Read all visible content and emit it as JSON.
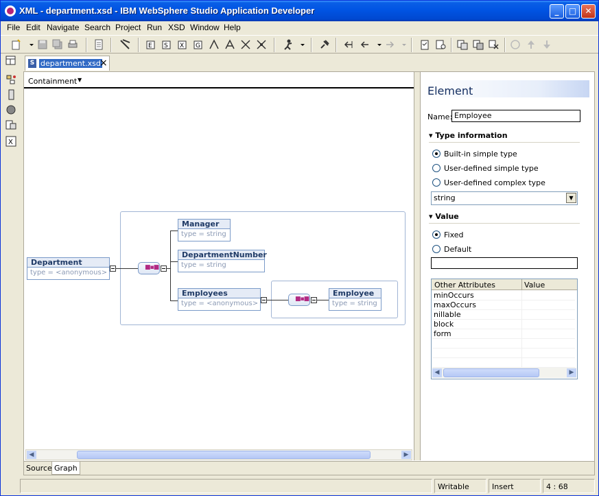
{
  "window": {
    "title": "XML - department.xsd - IBM WebSphere Studio Application Developer"
  },
  "menu": [
    "File",
    "Edit",
    "Navigate",
    "Search",
    "Project",
    "Run",
    "XSD",
    "Window",
    "Help"
  ],
  "editor": {
    "tab_label": "department.xsd",
    "view_selector": "Containment",
    "bottom_tabs": [
      "Source",
      "Graph"
    ]
  },
  "diagram": {
    "department": {
      "name": "Department",
      "type": "type = <anonymous>"
    },
    "manager": {
      "name": "Manager",
      "type": "type = string"
    },
    "department_number": {
      "name": "DepartmentNumber",
      "type": "type = string"
    },
    "employees": {
      "name": "Employees",
      "type": "type = <anonymous>"
    },
    "employee": {
      "name": "Employee",
      "type": "type = string"
    }
  },
  "properties": {
    "header": "Element",
    "name_label": "Name:",
    "name_value": "Employee",
    "type_section": "Type information",
    "type_options": [
      "Built-in simple type",
      "User-defined simple type",
      "User-defined complex type"
    ],
    "type_selected_index": 0,
    "type_value": "string",
    "value_section": "Value",
    "value_options": [
      "Fixed",
      "Default"
    ],
    "value_selected_index": 0,
    "value_text": "",
    "attributes_table": {
      "columns": [
        "Other Attributes",
        "Value"
      ],
      "rows": [
        "minOccurs",
        "maxOccurs",
        "nillable",
        "block",
        "form"
      ]
    }
  },
  "status": {
    "writable": "Writable",
    "insert": "Insert",
    "position": "4 : 68"
  }
}
